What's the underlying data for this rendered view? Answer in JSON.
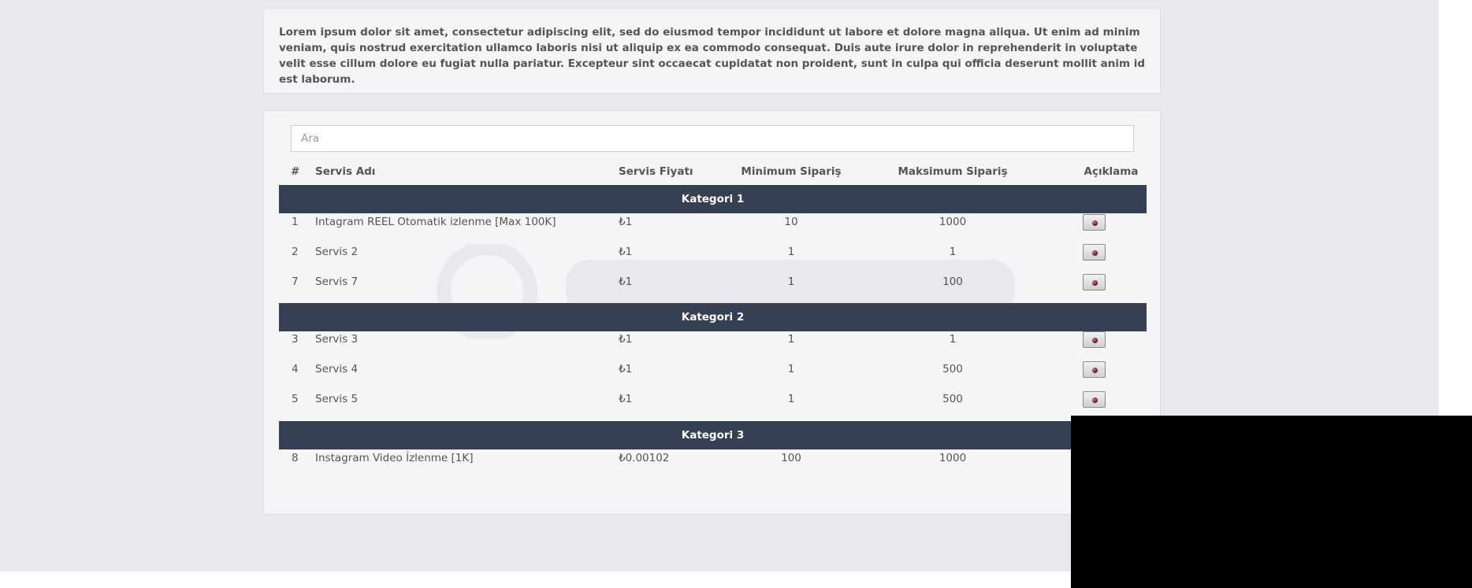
{
  "notice": {
    "text": "Lorem ipsum dolor sit amet, consectetur adipiscing elit, sed do eiusmod tempor incididunt ut labore et dolore magna aliqua. Ut enim ad minim veniam, quis nostrud exercitation ullamco laboris nisi ut aliquip ex ea commodo consequat. Duis aute irure dolor in reprehenderit in voluptate velit esse cillum dolore eu fugiat nulla pariatur. Excepteur sint occaecat cupidatat non proident, sunt in culpa qui officia deserunt mollit anim id est laborum."
  },
  "search": {
    "placeholder": "Ara",
    "value": ""
  },
  "table": {
    "headers": {
      "num": "#",
      "name": "Servis Adı",
      "price": "Servis Fiyatı",
      "min": "Minimum Sipariş",
      "max": "Maksimum Sipariş",
      "desc": "Açıklama"
    },
    "categories": [
      {
        "name": "Kategori 1",
        "rows": [
          {
            "num": "1",
            "name": "Intagram REEL Otomatik izlenme [Max 100K]",
            "price": "₺1",
            "min": "10",
            "max": "1000"
          },
          {
            "num": "2",
            "name": "Servis 2",
            "price": "₺1",
            "min": "1",
            "max": "1"
          },
          {
            "num": "7",
            "name": "Servis 7",
            "price": "₺1",
            "min": "1",
            "max": "100"
          }
        ]
      },
      {
        "name": "Kategori 2",
        "rows": [
          {
            "num": "3",
            "name": "Servis 3",
            "price": "₺1",
            "min": "1",
            "max": "1"
          },
          {
            "num": "4",
            "name": "Servis 4",
            "price": "₺1",
            "min": "1",
            "max": "500"
          },
          {
            "num": "5",
            "name": "Servis 5",
            "price": "₺1",
            "min": "1",
            "max": "500"
          }
        ]
      },
      {
        "name": "Kategori 3",
        "rows": [
          {
            "num": "8",
            "name": "Instagram Video İzlenme [1K]",
            "price": "₺0.00102",
            "min": "100",
            "max": "1000"
          }
        ]
      }
    ]
  },
  "colors": {
    "page_background": "#e9eaed",
    "card_background": "#f4f5f7",
    "category_bar": "#354052",
    "redaction": "#000000"
  },
  "icons": {
    "description_button": "info-dot-icon"
  }
}
